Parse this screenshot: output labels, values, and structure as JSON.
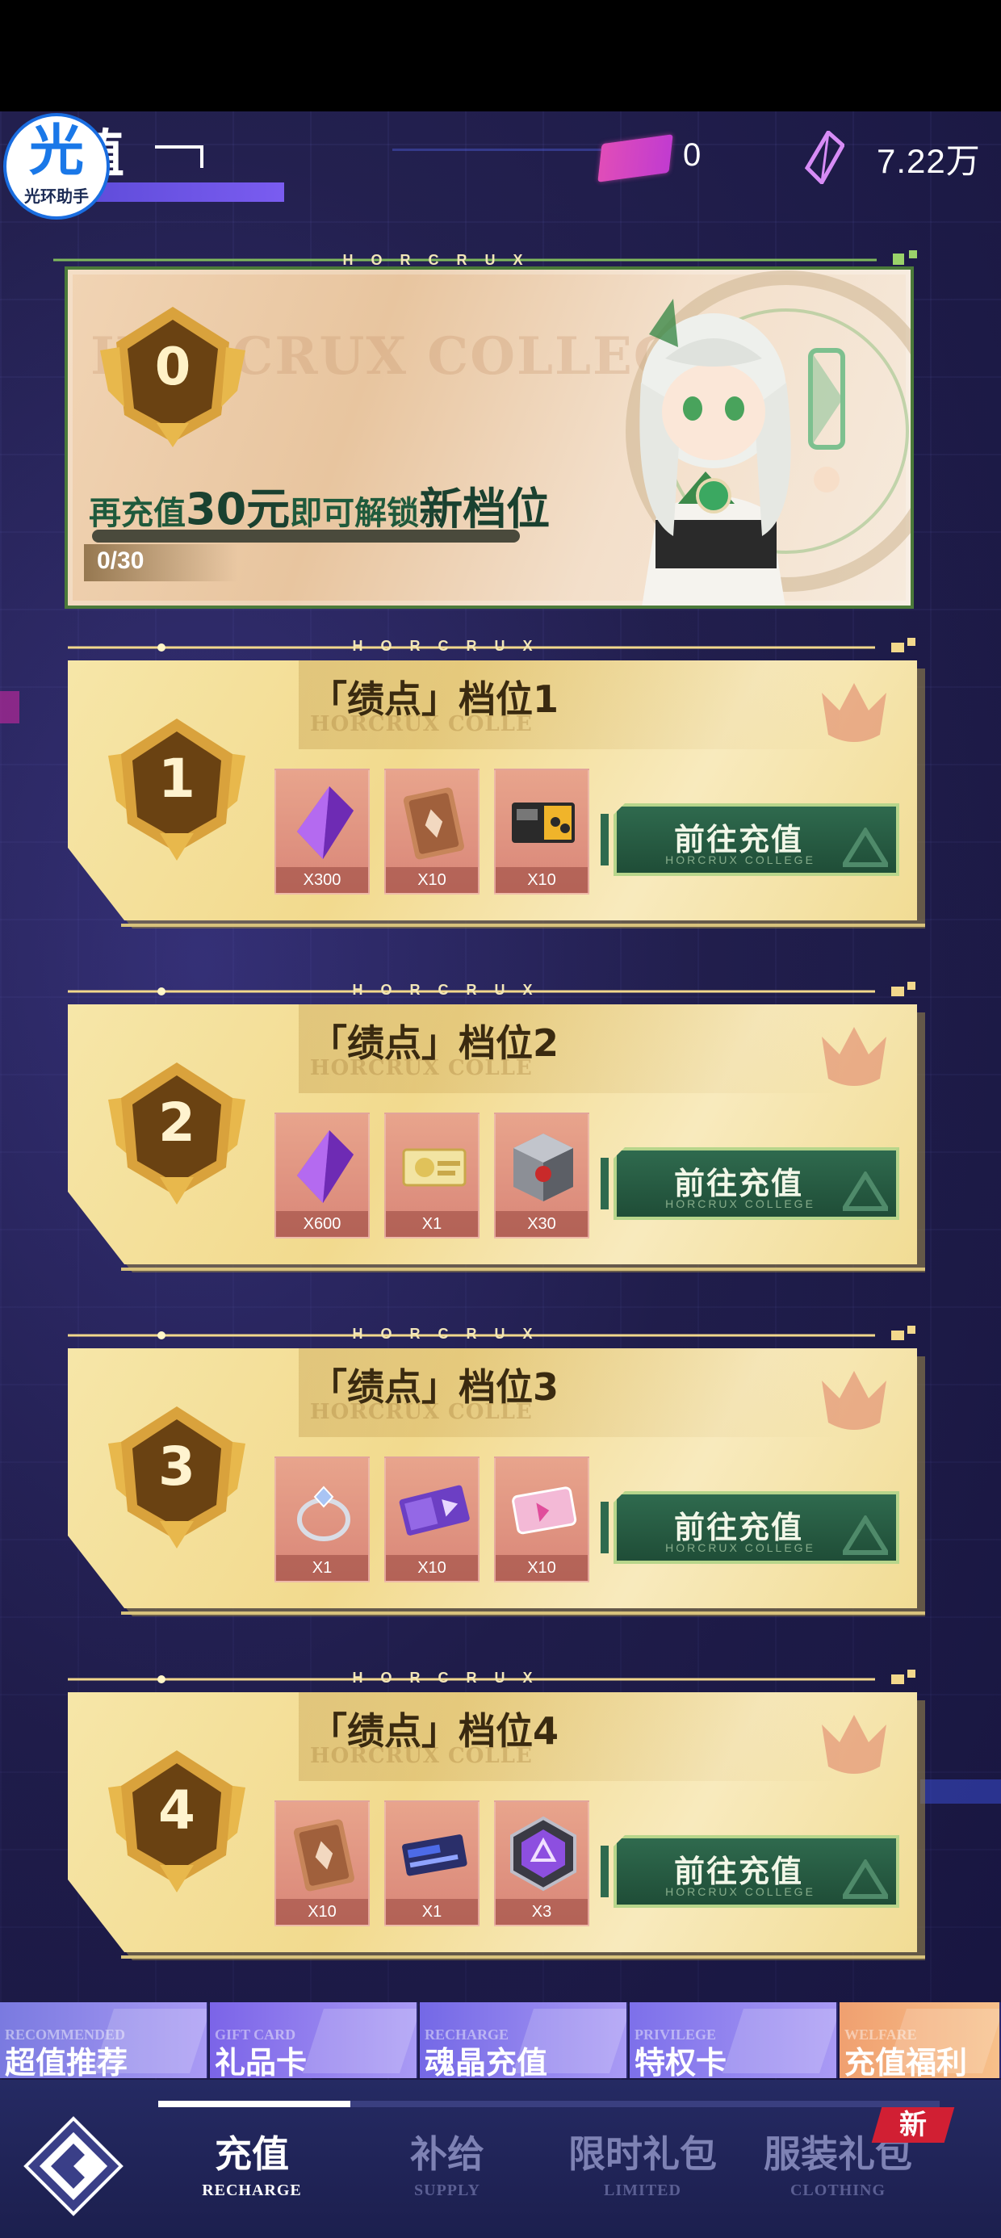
{
  "header": {
    "title_partial": "值",
    "logo_glyph": "光",
    "logo_caption": "光环助手",
    "ticket_count": "0",
    "crystal_count": "7.22万"
  },
  "hero": {
    "level": "0",
    "watermark": "HORCRUX COLLEGE",
    "head_label": "HORCRUX",
    "message_pre": "再充值",
    "message_amount": "30元",
    "message_mid": "即可解锁",
    "message_post": "新档位",
    "progress_text": "0/30",
    "progress_fraction": 0
  },
  "tiers": [
    {
      "level": "1",
      "title": "「绩点」档位1",
      "watermark": "HORCRUX COLLE",
      "head_label": "HORCRUX",
      "rewards": [
        {
          "icon": "crystal-icon",
          "qty": "X300"
        },
        {
          "icon": "card-pack-icon",
          "qty": "X10"
        },
        {
          "icon": "device-pass-icon",
          "qty": "X10"
        }
      ],
      "button_label": "前往充值",
      "button_sub": "HORCRUX COLLEGE"
    },
    {
      "level": "2",
      "title": "「绩点」档位2",
      "watermark": "HORCRUX COLLE",
      "head_label": "HORCRUX",
      "rewards": [
        {
          "icon": "crystal-icon",
          "qty": "X600"
        },
        {
          "icon": "gold-ticket-icon",
          "qty": "X1"
        },
        {
          "icon": "supply-crate-icon",
          "qty": "X30"
        }
      ],
      "button_label": "前往充值",
      "button_sub": "HORCRUX COLLEGE"
    },
    {
      "level": "3",
      "title": "「绩点」档位3",
      "watermark": "HORCRUX COLLE",
      "head_label": "HORCRUX",
      "rewards": [
        {
          "icon": "ring-icon",
          "qty": "X1"
        },
        {
          "icon": "purple-voucher-icon",
          "qty": "X10"
        },
        {
          "icon": "pink-voucher-icon",
          "qty": "X10"
        }
      ],
      "button_label": "前往充值",
      "button_sub": "HORCRUX COLLEGE"
    },
    {
      "level": "4",
      "title": "「绩点」档位4",
      "watermark": "HORCRUX COLLE",
      "head_label": "HORCRUX",
      "rewards": [
        {
          "icon": "card-pack-icon",
          "qty": "X10"
        },
        {
          "icon": "blue-card-icon",
          "qty": "X1"
        },
        {
          "icon": "hex-emblem-icon",
          "qty": "X3"
        }
      ],
      "button_label": "前往充值",
      "button_sub": "HORCRUX COLLEGE"
    }
  ],
  "categories": [
    {
      "en": "RECOMMENDED",
      "zh": "超值推荐",
      "color": "#7a7ae0"
    },
    {
      "en": "GIFT CARD",
      "zh": "礼品卡",
      "color": "#7b64e8"
    },
    {
      "en": "RECHARGE",
      "zh": "魂晶充值",
      "color": "#7468e6"
    },
    {
      "en": "PRIVILEGE",
      "zh": "特权卡",
      "color": "#7d70ea"
    },
    {
      "en": "WELFARE",
      "zh": "充值福利",
      "color": "#f0a070"
    }
  ],
  "tabs": [
    {
      "zh": "充值",
      "en": "RECHARGE",
      "active": true
    },
    {
      "zh": "补给",
      "en": "SUPPLY",
      "active": false
    },
    {
      "zh": "限时礼包",
      "en": "LIMITED",
      "active": false
    },
    {
      "zh": "服装礼包",
      "en": "CLOTHING",
      "active": false
    }
  ],
  "new_badge": "新",
  "colors": {
    "accent_green": "#2f6a4e",
    "card_gold": "#f2da8e",
    "tab_bg": "#252a63",
    "new_red": "#d11f33"
  }
}
